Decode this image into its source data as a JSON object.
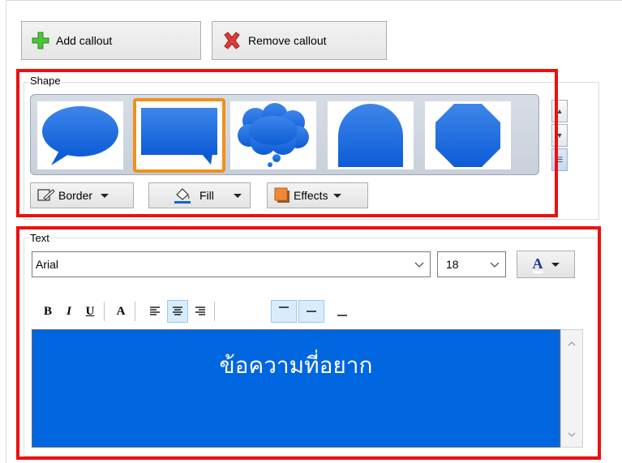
{
  "toolbar": {
    "add_label": "Add callout",
    "remove_label": "Remove callout"
  },
  "shape_section": {
    "label": "Shape",
    "shapes": [
      "oval-callout",
      "rectangle-callout",
      "cloud-callout",
      "rounded-corner-callout",
      "octagon-callout"
    ],
    "selected_index": 1,
    "buttons": {
      "border": "Border",
      "fill": "Fill",
      "effects": "Effects"
    }
  },
  "text_section": {
    "label": "Text",
    "font": "Arial",
    "size": "18",
    "content": "ข้อความที่อยาก"
  },
  "colors": {
    "highlight": "#ee0f0f",
    "selection": "#f0901a",
    "shape_blue": "#1a6fe0",
    "text_bg": "#0066e0"
  }
}
